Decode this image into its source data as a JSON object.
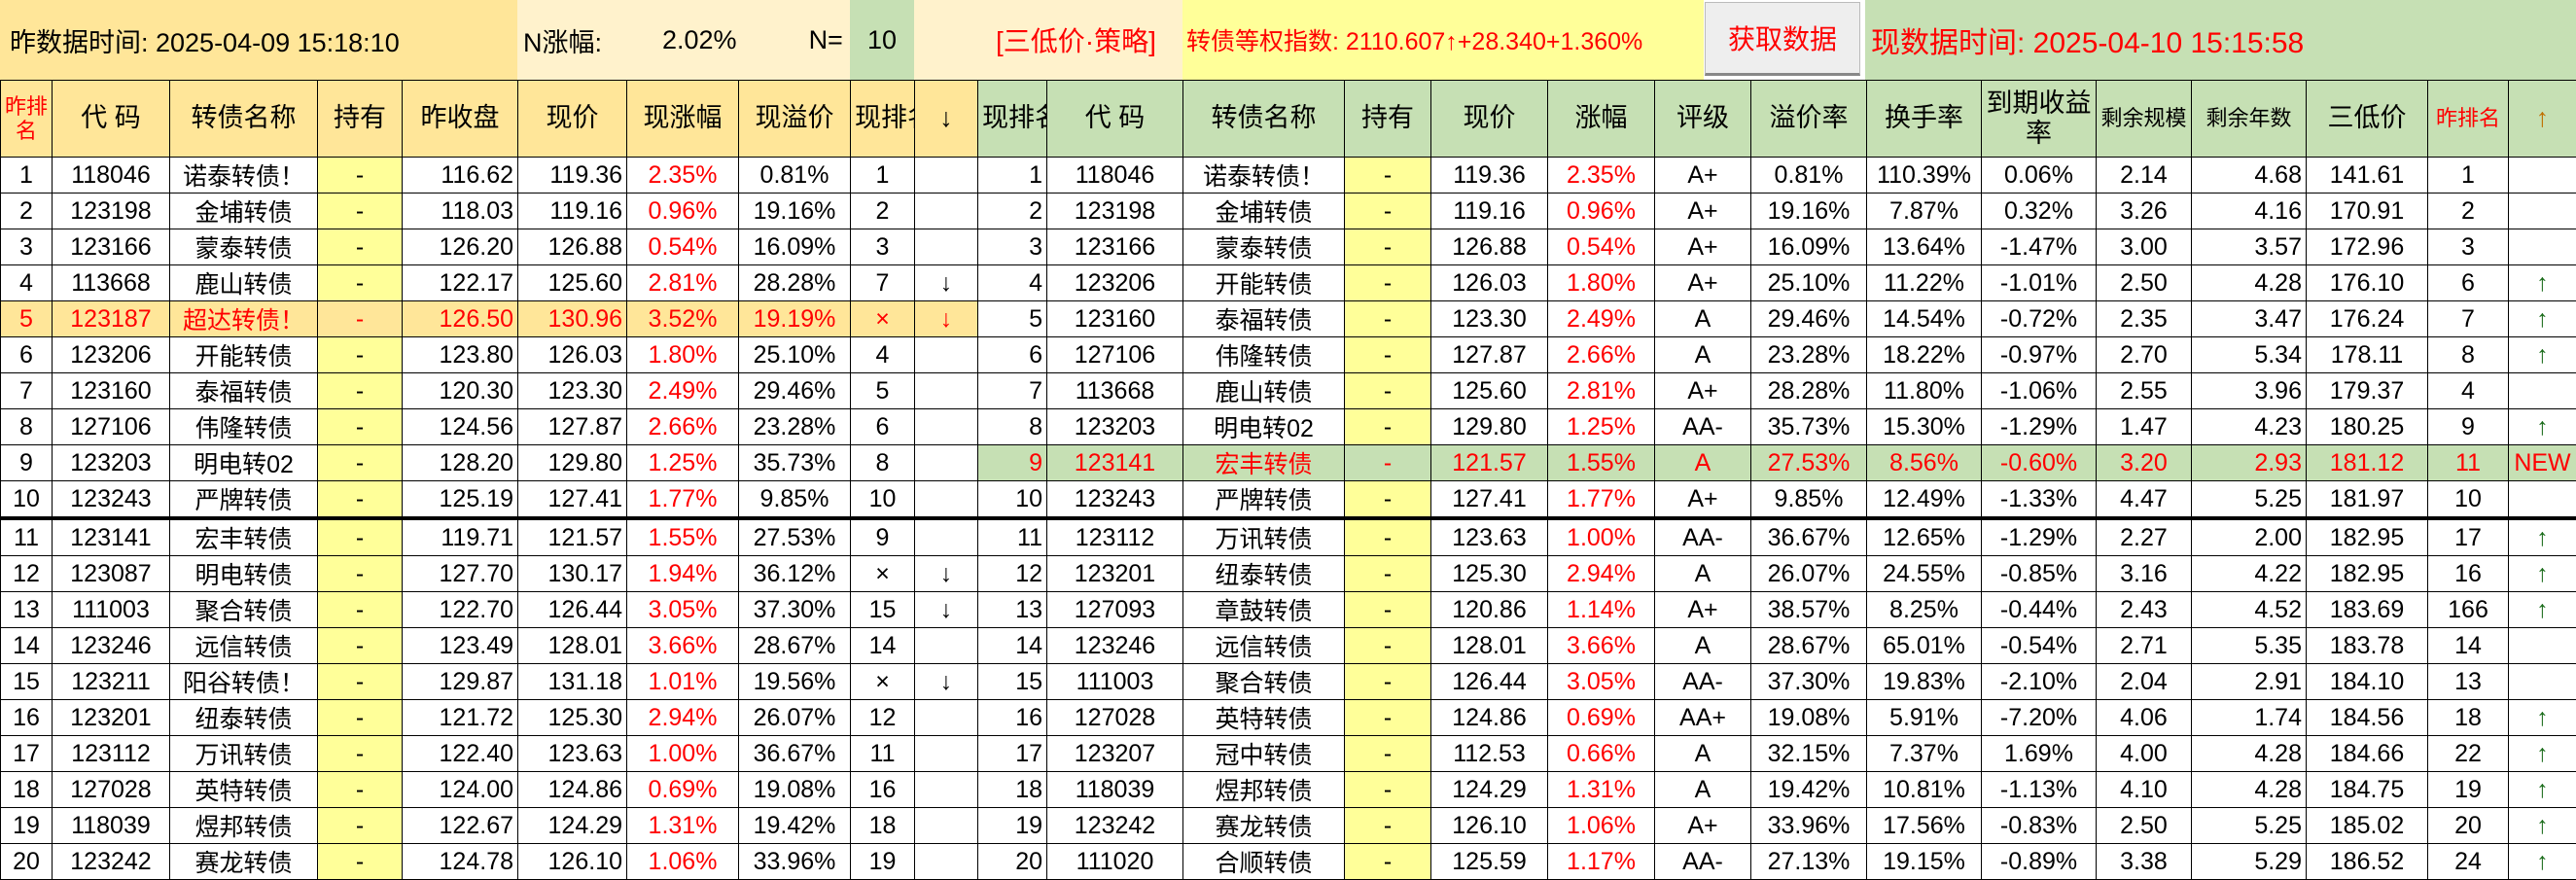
{
  "top": {
    "prev_time": "昨数据时间: 2025-04-09 15:18:10",
    "n_change_label": "N涨幅:",
    "n_change_value": "2.02%",
    "n_label": "N=",
    "n_value": "10",
    "strategy": "[三低价·策略]",
    "index_text": "转债等权指数:  2110.607↑+28.340+1.360%",
    "fetch_button": "获取数据",
    "now_time": "现数据时间: 2025-04-10 15:15:58"
  },
  "left": {
    "headers": [
      "昨排名",
      "代 码",
      "转债名称",
      "持有",
      "昨收盘",
      "现价",
      "现涨幅",
      "现溢价",
      "现排名",
      "↓"
    ],
    "rows": [
      [
        "1",
        "118046",
        "诺泰转债！",
        "-",
        "116.62",
        "119.36",
        "2.35%",
        "0.81%",
        "1",
        ""
      ],
      [
        "2",
        "123198",
        "金埔转债",
        "-",
        "118.03",
        "119.16",
        "0.96%",
        "19.16%",
        "2",
        ""
      ],
      [
        "3",
        "123166",
        "蒙泰转债",
        "-",
        "126.20",
        "126.88",
        "0.54%",
        "16.09%",
        "3",
        ""
      ],
      [
        "4",
        "113668",
        "鹿山转债",
        "-",
        "122.17",
        "125.60",
        "2.81%",
        "28.28%",
        "7",
        "↓"
      ],
      [
        "5",
        "123187",
        "超达转债！",
        "-",
        "126.50",
        "130.96",
        "3.52%",
        "19.19%",
        "×",
        "↓"
      ],
      [
        "6",
        "123206",
        "开能转债",
        "-",
        "123.80",
        "126.03",
        "1.80%",
        "25.10%",
        "4",
        ""
      ],
      [
        "7",
        "123160",
        "泰福转债",
        "-",
        "120.30",
        "123.30",
        "2.49%",
        "29.46%",
        "5",
        ""
      ],
      [
        "8",
        "127106",
        "伟隆转债",
        "-",
        "124.56",
        "127.87",
        "2.66%",
        "23.28%",
        "6",
        ""
      ],
      [
        "9",
        "123203",
        "明电转02",
        "-",
        "128.20",
        "129.80",
        "1.25%",
        "35.73%",
        "8",
        ""
      ],
      [
        "10",
        "123243",
        "严牌转债",
        "-",
        "125.19",
        "127.41",
        "1.77%",
        "9.85%",
        "10",
        ""
      ],
      [
        "11",
        "123141",
        "宏丰转债",
        "-",
        "119.71",
        "121.57",
        "1.55%",
        "27.53%",
        "9",
        ""
      ],
      [
        "12",
        "123087",
        "明电转债",
        "-",
        "127.70",
        "130.17",
        "1.94%",
        "36.12%",
        "×",
        "↓"
      ],
      [
        "13",
        "111003",
        "聚合转债",
        "-",
        "122.70",
        "126.44",
        "3.05%",
        "37.30%",
        "15",
        "↓"
      ],
      [
        "14",
        "123246",
        "远信转债",
        "-",
        "123.49",
        "128.01",
        "3.66%",
        "28.67%",
        "14",
        ""
      ],
      [
        "15",
        "123211",
        "阳谷转债！",
        "-",
        "129.87",
        "131.18",
        "1.01%",
        "19.56%",
        "×",
        "↓"
      ],
      [
        "16",
        "123201",
        "纽泰转债",
        "-",
        "121.72",
        "125.30",
        "2.94%",
        "26.07%",
        "12",
        ""
      ],
      [
        "17",
        "123112",
        "万讯转债",
        "-",
        "122.40",
        "123.63",
        "1.00%",
        "36.67%",
        "11",
        ""
      ],
      [
        "18",
        "127028",
        "英特转债",
        "-",
        "124.00",
        "124.86",
        "0.69%",
        "19.08%",
        "16",
        ""
      ],
      [
        "19",
        "118039",
        "煜邦转债",
        "-",
        "122.67",
        "124.29",
        "1.31%",
        "19.42%",
        "18",
        ""
      ],
      [
        "20",
        "123242",
        "赛龙转债",
        "-",
        "124.78",
        "126.10",
        "1.06%",
        "33.96%",
        "19",
        ""
      ]
    ]
  },
  "right": {
    "headers": [
      "现排名",
      "代 码",
      "转债名称",
      "持有",
      "现价",
      "涨幅",
      "评级",
      "溢价率",
      "换手率",
      "到期收益率",
      "剩余规模",
      "剩余年数",
      "三低价",
      "昨排名",
      "↑"
    ],
    "rows": [
      [
        "1",
        "118046",
        "诺泰转债！",
        "-",
        "119.36",
        "2.35%",
        "A+",
        "0.81%",
        "110.39%",
        "0.06%",
        "2.14",
        "4.68",
        "141.61",
        "1",
        ""
      ],
      [
        "2",
        "123198",
        "金埔转债",
        "-",
        "119.16",
        "0.96%",
        "A+",
        "19.16%",
        "7.87%",
        "0.32%",
        "3.26",
        "4.16",
        "170.91",
        "2",
        ""
      ],
      [
        "3",
        "123166",
        "蒙泰转债",
        "-",
        "126.88",
        "0.54%",
        "A+",
        "16.09%",
        "13.64%",
        "-1.47%",
        "3.00",
        "3.57",
        "172.96",
        "3",
        ""
      ],
      [
        "4",
        "123206",
        "开能转债",
        "-",
        "126.03",
        "1.80%",
        "A+",
        "25.10%",
        "11.22%",
        "-1.01%",
        "2.50",
        "4.28",
        "176.10",
        "6",
        "↑"
      ],
      [
        "5",
        "123160",
        "泰福转债",
        "-",
        "123.30",
        "2.49%",
        "A",
        "29.46%",
        "14.54%",
        "-0.72%",
        "2.35",
        "3.47",
        "176.24",
        "7",
        "↑"
      ],
      [
        "6",
        "127106",
        "伟隆转债",
        "-",
        "127.87",
        "2.66%",
        "A",
        "23.28%",
        "18.22%",
        "-0.97%",
        "2.70",
        "5.34",
        "178.11",
        "8",
        "↑"
      ],
      [
        "7",
        "113668",
        "鹿山转债",
        "-",
        "125.60",
        "2.81%",
        "A+",
        "28.28%",
        "11.80%",
        "-1.06%",
        "2.55",
        "3.96",
        "179.37",
        "4",
        ""
      ],
      [
        "8",
        "123203",
        "明电转02",
        "-",
        "129.80",
        "1.25%",
        "AA-",
        "35.73%",
        "15.30%",
        "-1.29%",
        "1.47",
        "4.23",
        "180.25",
        "9",
        "↑"
      ],
      [
        "9",
        "123141",
        "宏丰转债",
        "-",
        "121.57",
        "1.55%",
        "A",
        "27.53%",
        "8.56%",
        "-0.60%",
        "3.20",
        "2.93",
        "181.12",
        "11",
        "NEW"
      ],
      [
        "10",
        "123243",
        "严牌转债",
        "-",
        "127.41",
        "1.77%",
        "A+",
        "9.85%",
        "12.49%",
        "-1.33%",
        "4.47",
        "5.25",
        "181.97",
        "10",
        ""
      ],
      [
        "11",
        "123112",
        "万讯转债",
        "-",
        "123.63",
        "1.00%",
        "AA-",
        "36.67%",
        "12.65%",
        "-1.29%",
        "2.27",
        "2.00",
        "182.95",
        "17",
        "↑"
      ],
      [
        "12",
        "123201",
        "纽泰转债",
        "-",
        "125.30",
        "2.94%",
        "A",
        "26.07%",
        "24.55%",
        "-0.85%",
        "3.16",
        "4.22",
        "182.95",
        "16",
        "↑"
      ],
      [
        "13",
        "127093",
        "章鼓转债",
        "-",
        "120.86",
        "1.14%",
        "A+",
        "38.57%",
        "8.25%",
        "-0.44%",
        "2.43",
        "4.52",
        "183.69",
        "166",
        "↑"
      ],
      [
        "14",
        "123246",
        "远信转债",
        "-",
        "128.01",
        "3.66%",
        "A",
        "28.67%",
        "65.01%",
        "-0.54%",
        "2.71",
        "5.35",
        "183.78",
        "14",
        ""
      ],
      [
        "15",
        "111003",
        "聚合转债",
        "-",
        "126.44",
        "3.05%",
        "AA-",
        "37.30%",
        "19.83%",
        "-2.10%",
        "2.04",
        "2.91",
        "184.10",
        "13",
        ""
      ],
      [
        "16",
        "127028",
        "英特转债",
        "-",
        "124.86",
        "0.69%",
        "AA+",
        "19.08%",
        "5.91%",
        "-7.20%",
        "4.06",
        "1.74",
        "184.56",
        "18",
        "↑"
      ],
      [
        "17",
        "123207",
        "冠中转债",
        "-",
        "112.53",
        "0.66%",
        "A",
        "32.15%",
        "7.37%",
        "1.69%",
        "4.00",
        "4.28",
        "184.66",
        "22",
        "↑"
      ],
      [
        "18",
        "118039",
        "煜邦转债",
        "-",
        "124.29",
        "1.31%",
        "A",
        "19.42%",
        "10.81%",
        "-1.13%",
        "4.10",
        "4.28",
        "184.75",
        "19",
        "↑"
      ],
      [
        "19",
        "123242",
        "赛龙转债",
        "-",
        "126.10",
        "1.06%",
        "A+",
        "33.96%",
        "17.56%",
        "-0.83%",
        "2.50",
        "5.25",
        "185.02",
        "20",
        "↑"
      ],
      [
        "20",
        "111020",
        "合顺转债",
        "-",
        "125.59",
        "1.17%",
        "AA-",
        "27.13%",
        "19.15%",
        "-0.89%",
        "3.38",
        "5.29",
        "186.52",
        "24",
        "↑"
      ]
    ]
  }
}
